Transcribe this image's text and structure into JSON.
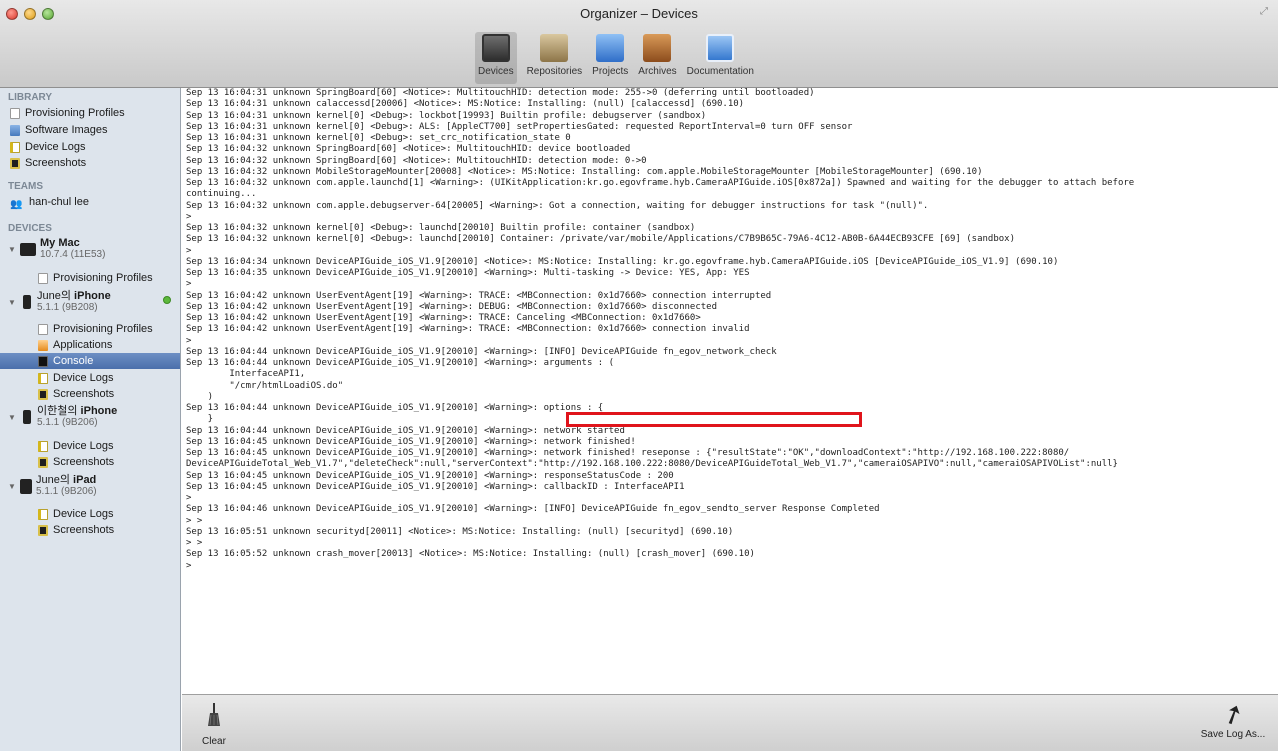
{
  "window": {
    "title": "Organizer – Devices"
  },
  "toolbar": {
    "items": [
      {
        "label": "Devices",
        "icon": "devices-icon",
        "selected": true
      },
      {
        "label": "Repositories",
        "icon": "repositories-icon"
      },
      {
        "label": "Projects",
        "icon": "projects-icon"
      },
      {
        "label": "Archives",
        "icon": "archives-icon"
      },
      {
        "label": "Documentation",
        "icon": "documentation-icon"
      }
    ]
  },
  "sidebar": {
    "library_header": "LIBRARY",
    "library": [
      "Provisioning Profiles",
      "Software Images",
      "Device Logs",
      "Screenshots"
    ],
    "teams_header": "TEAMS",
    "team": "han-chul lee",
    "devices_header": "DEVICES",
    "devices": [
      {
        "name": "My Mac",
        "sub": "10.7.4 (11E53)",
        "children": [
          "Provisioning Profiles"
        ]
      },
      {
        "owner": "June의",
        "name": "iPhone",
        "sub": "5.1.1 (9B208)",
        "connected": true,
        "children": [
          "Provisioning Profiles",
          "Applications",
          "Console",
          "Device Logs",
          "Screenshots"
        ]
      },
      {
        "owner": "이한철의",
        "name": "iPhone",
        "sub": "5.1.1 (9B206)",
        "children": [
          "Device Logs",
          "Screenshots"
        ]
      },
      {
        "owner": "June의",
        "name": "iPad",
        "sub": "5.1.1 (9B206)",
        "children": [
          "Device Logs",
          "Screenshots"
        ]
      }
    ],
    "selected_item": "Console"
  },
  "console": {
    "lines": [
      "Sep 13 16:04:31 unknown SpringBoard[60] <Notice>: MultitouchHID: detection mode: 255->0 (deferring until bootloaded)",
      "Sep 13 16:04:31 unknown calaccessd[20006] <Notice>: MS:Notice: Installing: (null) [calaccessd] (690.10)",
      "Sep 13 16:04:31 unknown kernel[0] <Debug>: lockbot[19993] Builtin profile: debugserver (sandbox)",
      "Sep 13 16:04:31 unknown kernel[0] <Debug>: ALS: [AppleCT700] setPropertiesGated: requested ReportInterval=0 turn OFF sensor",
      "Sep 13 16:04:31 unknown kernel[0] <Debug>: set_crc_notification_state 0",
      "Sep 13 16:04:32 unknown SpringBoard[60] <Notice>: MultitouchHID: device bootloaded",
      "Sep 13 16:04:32 unknown SpringBoard[60] <Notice>: MultitouchHID: detection mode: 0->0",
      "Sep 13 16:04:32 unknown MobileStorageMounter[20008] <Notice>: MS:Notice: Installing: com.apple.MobileStorageMounter [MobileStorageMounter] (690.10)",
      "Sep 13 16:04:32 unknown com.apple.launchd[1] <Warning>: (UIKitApplication:kr.go.egovframe.hyb.CameraAPIGuide.iOS[0x872a]) Spawned and waiting for the debugger to attach before",
      "continuing...",
      "Sep 13 16:04:32 unknown com.apple.debugserver-64[20005] <Warning>: Got a connection, waiting for debugger instructions for task \"(null)\".",
      ">",
      "Sep 13 16:04:32 unknown kernel[0] <Debug>: launchd[20010] Builtin profile: container (sandbox)",
      "Sep 13 16:04:32 unknown kernel[0] <Debug>: launchd[20010] Container: /private/var/mobile/Applications/C7B9B65C-79A6-4C12-AB0B-6A44ECB93CFE [69] (sandbox)",
      ">",
      "Sep 13 16:04:34 unknown DeviceAPIGuide_iOS_V1.9[20010] <Notice>: MS:Notice: Installing: kr.go.egovframe.hyb.CameraAPIGuide.iOS [DeviceAPIGuide_iOS_V1.9] (690.10)",
      "Sep 13 16:04:35 unknown DeviceAPIGuide_iOS_V1.9[20010] <Warning>: Multi-tasking -> Device: YES, App: YES",
      ">",
      "Sep 13 16:04:42 unknown UserEventAgent[19] <Warning>: TRACE: <MBConnection: 0x1d7660> connection interrupted",
      "Sep 13 16:04:42 unknown UserEventAgent[19] <Warning>: DEBUG: <MBConnection: 0x1d7660> disconnected",
      "Sep 13 16:04:42 unknown UserEventAgent[19] <Warning>: TRACE: Canceling <MBConnection: 0x1d7660>",
      "Sep 13 16:04:42 unknown UserEventAgent[19] <Warning>: TRACE: <MBConnection: 0x1d7660> connection invalid",
      ">",
      "Sep 13 16:04:44 unknown DeviceAPIGuide_iOS_V1.9[20010] <Warning>: [INFO] DeviceAPIGuide fn_egov_network_check",
      "Sep 13 16:04:44 unknown DeviceAPIGuide_iOS_V1.9[20010] <Warning>: arguments : (",
      "        InterfaceAPI1,",
      "        \"/cmr/htmlLoadiOS.do\"",
      "    )",
      "Sep 13 16:04:44 unknown DeviceAPIGuide_iOS_V1.9[20010] <Warning>: options : {",
      "    }",
      "Sep 13 16:04:44 unknown DeviceAPIGuide_iOS_V1.9[20010] <Warning>: network started",
      "Sep 13 16:04:45 unknown DeviceAPIGuide_iOS_V1.9[20010] <Warning>: network finished!",
      "Sep 13 16:04:45 unknown DeviceAPIGuide_iOS_V1.9[20010] <Warning>: network finished! reseponse : {\"resultState\":\"OK\",\"downloadContext\":\"http://192.168.100.222:8080/",
      "DeviceAPIGuideTotal_Web_V1.7\",\"deleteCheck\":null,\"serverContext\":\"http://192.168.100.222:8080/DeviceAPIGuideTotal_Web_V1.7\",\"cameraiOSAPIVO\":null,\"cameraiOSAPIVOList\":null}",
      "Sep 13 16:04:45 unknown DeviceAPIGuide_iOS_V1.9[20010] <Warning>: responseStatusCode : 200",
      "Sep 13 16:04:45 unknown DeviceAPIGuide_iOS_V1.9[20010] <Warning>: callbackID : InterfaceAPI1",
      ">",
      "Sep 13 16:04:46 unknown DeviceAPIGuide_iOS_V1.9[20010] <Warning>: [INFO] DeviceAPIGuide fn_egov_sendto_server Response Completed",
      "> >",
      "Sep 13 16:05:51 unknown securityd[20011] <Notice>: MS:Notice: Installing: (null) [securityd] (690.10)",
      "> >",
      "Sep 13 16:05:52 unknown crash_mover[20013] <Notice>: MS:Notice: Installing: (null) [crash_mover] (690.10)",
      ">"
    ]
  },
  "bottombar": {
    "clear_label": "Clear",
    "save_label": "Save Log As..."
  }
}
